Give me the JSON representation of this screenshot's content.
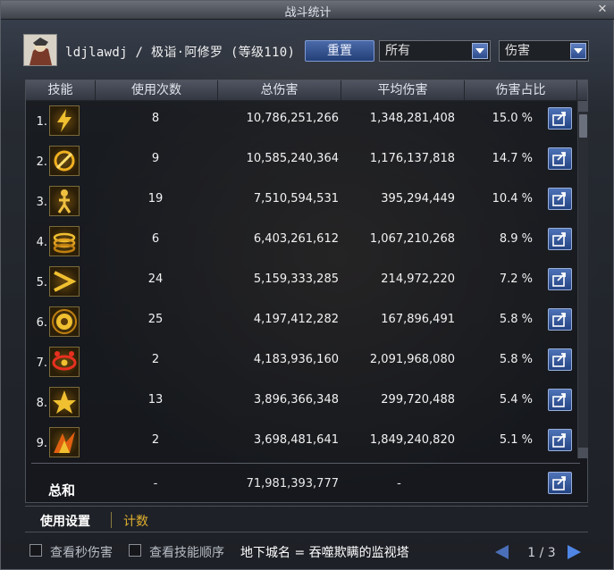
{
  "window": {
    "title": "战斗统计"
  },
  "header": {
    "player_info": "ldjlawdj / 极诣·阿修罗 (等级110)",
    "reset_label": "重置",
    "filter_target": "所有",
    "filter_metric": "伤害"
  },
  "table": {
    "columns": [
      "技能",
      "使用次数",
      "总伤害",
      "平均伤害",
      "伤害占比"
    ],
    "rows": [
      {
        "rank": "1.",
        "count": "8",
        "total": "10,786,251,266",
        "avg": "1,348,281,408",
        "pct": "15.0 %"
      },
      {
        "rank": "2.",
        "count": "9",
        "total": "10,585,240,364",
        "avg": "1,176,137,818",
        "pct": "14.7 %"
      },
      {
        "rank": "3.",
        "count": "19",
        "total": "7,510,594,531",
        "avg": "395,294,449",
        "pct": "10.4 %"
      },
      {
        "rank": "4.",
        "count": "6",
        "total": "6,403,261,612",
        "avg": "1,067,210,268",
        "pct": "8.9 %"
      },
      {
        "rank": "5.",
        "count": "24",
        "total": "5,159,333,285",
        "avg": "214,972,220",
        "pct": "7.2 %"
      },
      {
        "rank": "6.",
        "count": "25",
        "total": "4,197,412,282",
        "avg": "167,896,491",
        "pct": "5.8 %"
      },
      {
        "rank": "7.",
        "count": "2",
        "total": "4,183,936,160",
        "avg": "2,091,968,080",
        "pct": "5.8 %"
      },
      {
        "rank": "8.",
        "count": "13",
        "total": "3,896,366,348",
        "avg": "299,720,488",
        "pct": "5.4 %"
      },
      {
        "rank": "9.",
        "count": "2",
        "total": "3,698,481,641",
        "avg": "1,849,240,820",
        "pct": "5.1 %"
      }
    ],
    "summary": {
      "label": "总和",
      "count": "-",
      "total": "71,981,393,777",
      "avg": "-"
    }
  },
  "tabs": {
    "settings": "使用设置",
    "counter": "计数"
  },
  "footer": {
    "show_per_second": "查看秒伤害",
    "show_skill_order": "查看技能顺序",
    "dungeon": "地下城名 = 吞噬欺瞒的监视塔",
    "page": "1 / 3"
  },
  "colors": {
    "accent_blue": "#3a5ca0",
    "tab_active": "#ffffff",
    "tab_inactive": "#e0b030"
  },
  "icons": [
    "lightning-skill-icon",
    "burst-skill-icon",
    "figure-skill-icon",
    "ring-skill-icon",
    "wave-skill-icon",
    "orb-skill-icon",
    "eye-skill-icon",
    "spike-skill-icon",
    "flame-skill-icon"
  ]
}
